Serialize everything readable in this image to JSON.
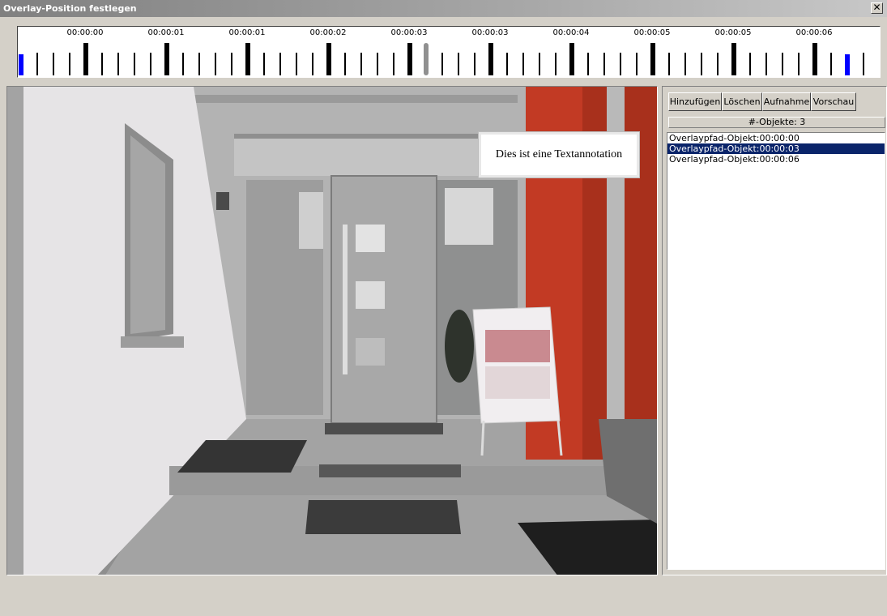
{
  "window": {
    "title": "Overlay-Position festlegen",
    "close_label": "✕"
  },
  "timeline": {
    "time_labels": [
      "00:00:00",
      "00:00:01",
      "00:00:01",
      "00:00:02",
      "00:00:03",
      "00:00:03",
      "00:00:04",
      "00:00:05",
      "00:00:05",
      "00:00:06"
    ],
    "keyframe_color": "#0000ff",
    "cursor_color": "#909090"
  },
  "annotation": {
    "text": "Dies ist eine Textannotation"
  },
  "toolbar": {
    "add_label": "Hinzufügen",
    "delete_label": "Löschen",
    "record_label": "Aufnahme",
    "preview_label": "Vorschau"
  },
  "objects": {
    "count_text": "#-Objekte: 3",
    "items": [
      {
        "label": "Overlaypfad-Objekt:00:00:00",
        "selected": false
      },
      {
        "label": "Overlaypfad-Objekt:00:00:03",
        "selected": true
      },
      {
        "label": "Overlaypfad-Objekt:00:00:06",
        "selected": false
      }
    ],
    "selection_color": "#0a246a"
  }
}
